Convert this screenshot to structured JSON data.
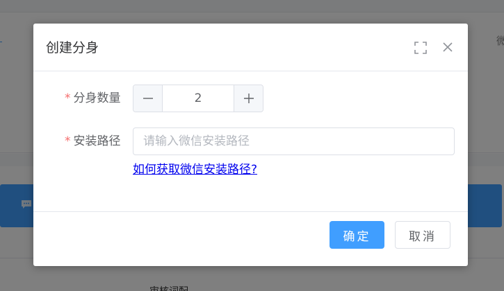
{
  "background": {
    "right_char": "微",
    "bottom_text": "审核词配",
    "accent_color": "#409eff"
  },
  "dialog": {
    "title": "创建分身",
    "header_icons": [
      "fullscreen-icon",
      "close-icon"
    ],
    "form": {
      "count_label": "分身数量",
      "count_value": "2",
      "required_mark": "*",
      "path_label": "安装路径",
      "path_placeholder": "请输入微信安装路径",
      "path_value": "",
      "help_link": "如何获取微信安装路径?"
    },
    "footer": {
      "confirm_label": "确定",
      "cancel_label": "取消"
    }
  }
}
